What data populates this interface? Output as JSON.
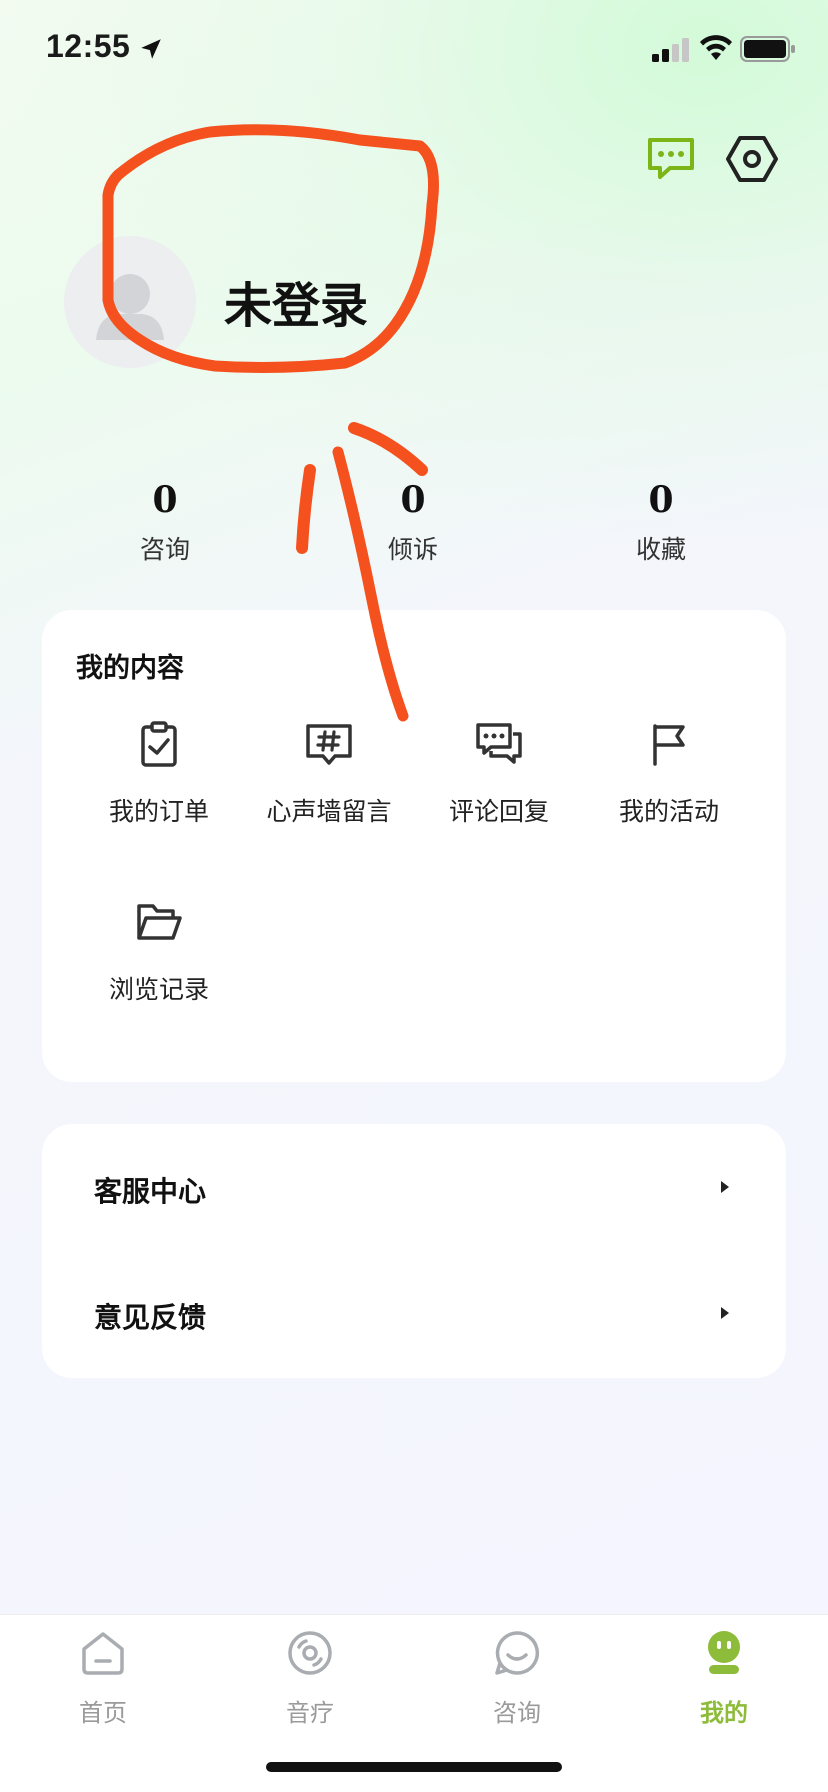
{
  "status_bar": {
    "time": "12:55"
  },
  "header": {
    "message_icon": "message-dots-icon",
    "settings_icon": "hexagon-settings-icon",
    "accent_color": "#7cb518"
  },
  "profile": {
    "title": "未登录",
    "avatar_icon": "default-avatar-icon"
  },
  "stats": [
    {
      "value": "0",
      "label": "咨询"
    },
    {
      "value": "0",
      "label": "倾诉"
    },
    {
      "value": "0",
      "label": "收藏"
    }
  ],
  "content_section": {
    "title": "我的内容",
    "items": [
      {
        "label": "我的订单",
        "icon": "clipboard-check-icon"
      },
      {
        "label": "心声墙留言",
        "icon": "hash-message-icon"
      },
      {
        "label": "评论回复",
        "icon": "chat-bubbles-icon"
      },
      {
        "label": "我的活动",
        "icon": "flag-icon"
      },
      {
        "label": "浏览记录",
        "icon": "folder-open-icon"
      }
    ]
  },
  "menu": [
    {
      "label": "客服中心",
      "icon": "chevron-right-icon"
    },
    {
      "label": "意见反馈",
      "icon": "chevron-right-icon"
    }
  ],
  "tab_bar": {
    "tabs": [
      {
        "label": "首页",
        "icon": "home-icon",
        "active": false
      },
      {
        "label": "音疗",
        "icon": "disc-icon",
        "active": false
      },
      {
        "label": "咨询",
        "icon": "smile-bubble-icon",
        "active": false
      },
      {
        "label": "我的",
        "icon": "robot-face-icon",
        "active": true
      }
    ],
    "active_color": "#8dbb3a",
    "inactive_color": "#9a9a9a"
  },
  "annotation": {
    "color": "#f4511e",
    "shapes": [
      "circle-around-title",
      "arrow-pointing-up"
    ]
  }
}
